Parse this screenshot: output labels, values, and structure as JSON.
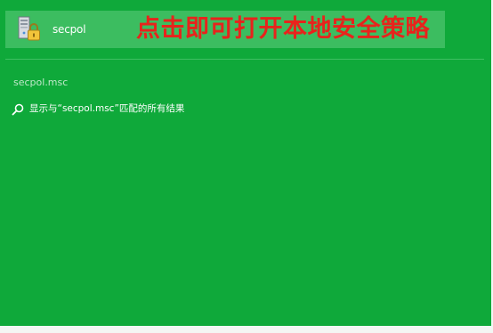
{
  "search_results": {
    "top_result": {
      "app_name": "secpol",
      "icon": "security-policy-icon"
    },
    "query_text": "secpol.msc",
    "search_all": {
      "icon": "search-icon",
      "label": "显示与“secpol.msc”匹配的所有结果"
    }
  },
  "annotation": {
    "caption": "点击即可打开本地安全策略",
    "color": "#e8231c"
  },
  "colors": {
    "background": "#0fa93a",
    "tile": "#3cbd60",
    "text": "#ffffff"
  }
}
